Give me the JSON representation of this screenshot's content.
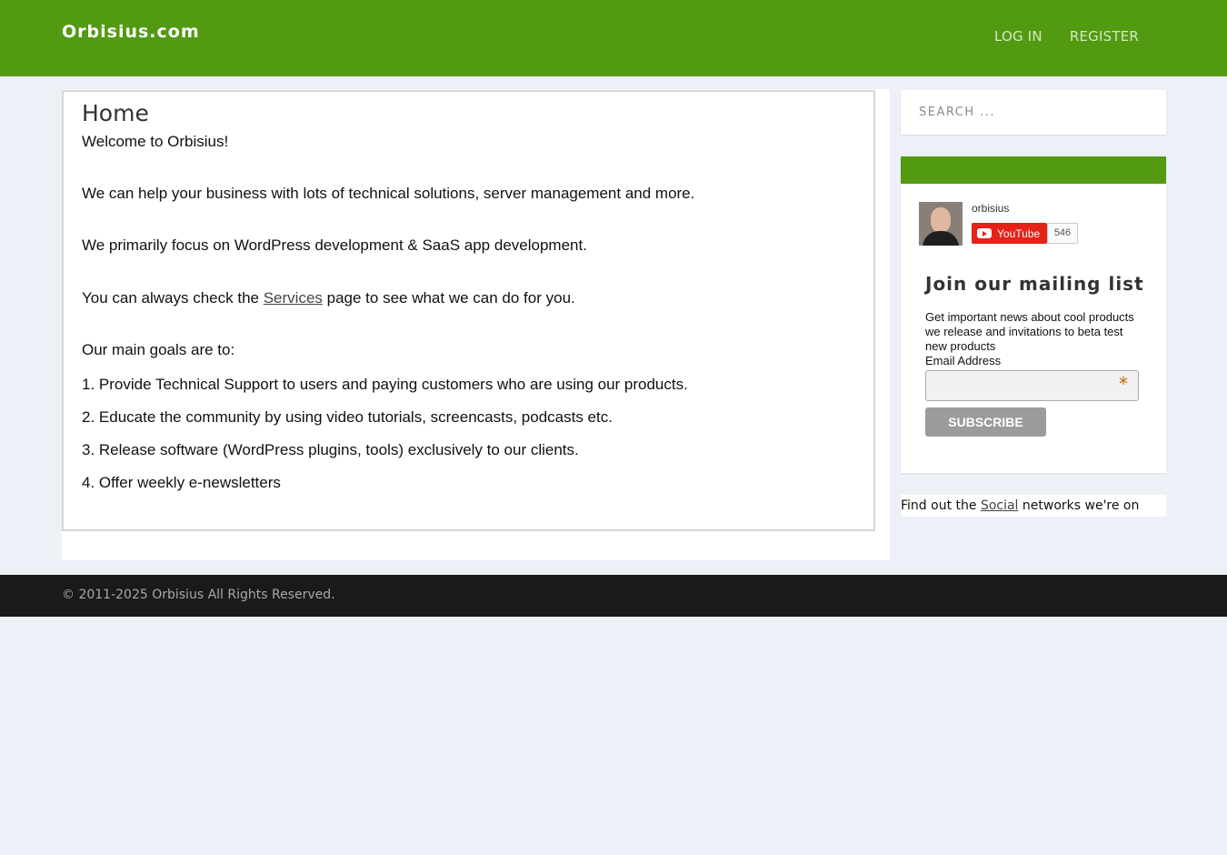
{
  "header": {
    "brand": "Orbisius.com",
    "nav": [
      "LOG IN",
      "REGISTER"
    ]
  },
  "main": {
    "title": "Home",
    "welcome": "Welcome to Orbisius!",
    "p1": "We can help your business with lots of technical solutions, server management and more.",
    "p2": "We primarily focus on WordPress development & SaaS app development.",
    "p3_before": "You can always check the ",
    "p3_link": "Services",
    "p3_after": " page to see what we can do for you.",
    "goals_intro": "Our main goals are to:",
    "goals": [
      "1. Provide Technical Support to users and paying customers who are using our products.",
      "2. Educate the community by using video tutorials, screencasts, podcasts etc.",
      "3. Release software (WordPress plugins, tools) exclusively to our clients.",
      "4. Offer weekly e-newsletters"
    ]
  },
  "sidebar": {
    "search_placeholder": "Search ...",
    "youtube": {
      "channel": "orbisius",
      "button": "YouTube",
      "count": "546"
    },
    "mailing": {
      "title": "Join our mailing list",
      "description": "Get important news about cool products we release and invitations to beta test new products",
      "email_label": "Email Address",
      "required_mark": "*",
      "subscribe": "Subscribe"
    },
    "social": {
      "before": "Find out the ",
      "link": "Social",
      "after": " networks we're on"
    }
  },
  "footer": {
    "copyright": "© 2011-2025 Orbisius All Rights Reserved."
  },
  "colors": {
    "header_green": "#529a12",
    "background": "#edf0f6",
    "footer": "#1a1a1a",
    "youtube_red": "#e62117"
  }
}
